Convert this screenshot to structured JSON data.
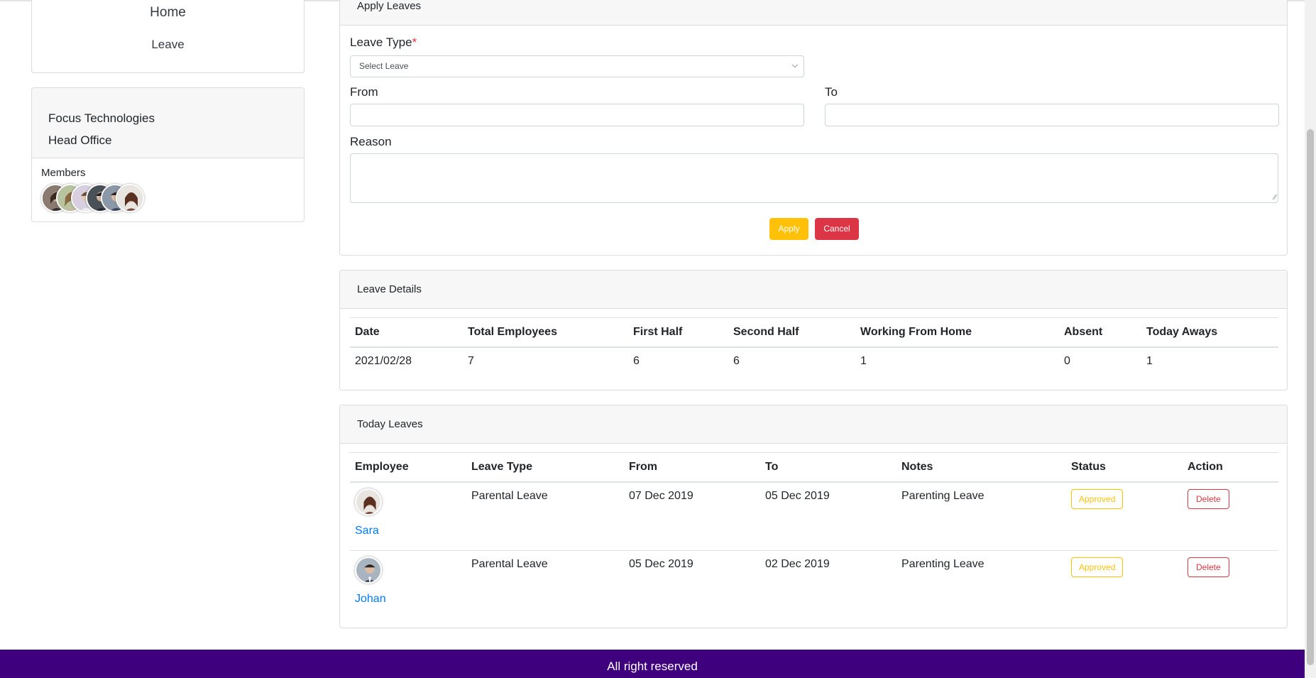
{
  "nav": {
    "home": "Home",
    "leave": "Leave"
  },
  "org": {
    "company": "Focus Technologies",
    "office": "Head Office",
    "members_label": "Members",
    "member_avatar_count": 6
  },
  "apply": {
    "title": "Apply Leaves",
    "leave_type_label": "Leave Type",
    "required_mark": "*",
    "select_value": "Select Leave",
    "from_label": "From",
    "to_label": "To",
    "reason_label": "Reason",
    "apply_button": "Apply",
    "cancel_button": "Cancel"
  },
  "leave_details": {
    "title": "Leave Details",
    "headers": [
      "Date",
      "Total Employees",
      "First Half",
      "Second Half",
      "Working From Home",
      "Absent",
      "Today Aways"
    ],
    "row": [
      "2021/02/28",
      "7",
      "6",
      "6",
      "1",
      "0",
      "1"
    ]
  },
  "today_leaves": {
    "title": "Today Leaves",
    "headers": [
      "Employee",
      "Leave Type",
      "From",
      "To",
      "Notes",
      "Status",
      "Action"
    ],
    "rows": [
      {
        "name": "Sara",
        "leave_type": "Parental Leave",
        "from": "07 Dec 2019",
        "to": "05 Dec 2019",
        "notes": "Parenting Leave",
        "status": "Approved",
        "action": "Delete"
      },
      {
        "name": "Johan",
        "leave_type": "Parental Leave",
        "from": "05 Dec 2019",
        "to": "02 Dec 2019",
        "notes": "Parenting Leave",
        "status": "Approved",
        "action": "Delete"
      }
    ]
  },
  "footer": {
    "text": "All right reserved"
  },
  "colors": {
    "footer_bg": "#3f007d",
    "apply_btn": "#ffc107",
    "cancel_btn": "#dc3545",
    "link": "#007bff"
  }
}
